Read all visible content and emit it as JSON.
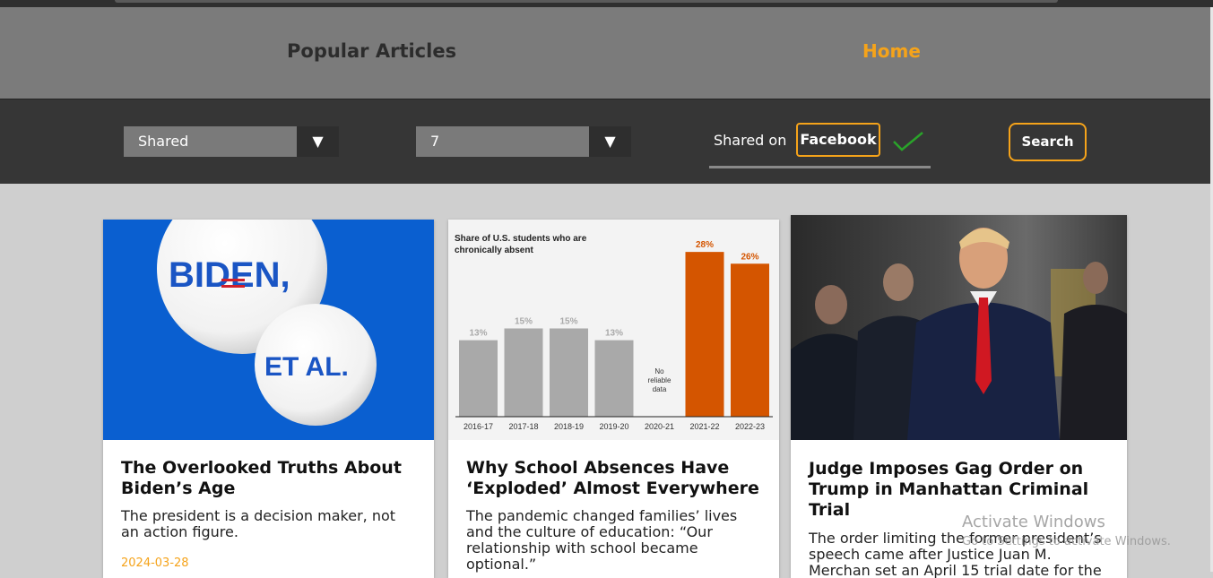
{
  "header": {
    "title": "Popular Articles",
    "home_label": "Home"
  },
  "filters": {
    "type_selected": "Shared",
    "days_selected": "7",
    "shared_on_label": "Shared on",
    "platform_label": "Facebook",
    "search_label": "Search"
  },
  "colors": {
    "accent": "#f5a31a",
    "header_bg": "#7b7b7b",
    "filterbar_bg": "#363636",
    "check": "#2aa32a"
  },
  "articles": [
    {
      "title": "The Overlooked Truths About Biden’s Age",
      "abstract": "The president is a decision maker, not an action figure.",
      "date": "2024-03-28",
      "image": {
        "button_top": "BIDEN,",
        "button_bottom": "ET AL."
      }
    },
    {
      "title": "Why School Absences Have ‘Exploded’ Almost Everywhere",
      "abstract": "The pandemic changed families’ lives and the culture of education: “Our relationship with school became optional.”",
      "image": {
        "chart_data": {
          "type": "bar",
          "title": "Share of U.S. students who are chronically absent",
          "categories": [
            "2016-17",
            "2017-18",
            "2018-19",
            "2019-20",
            "2020-21",
            "2021-22",
            "2022-23"
          ],
          "values": [
            13,
            15,
            15,
            13,
            null,
            28,
            26
          ],
          "labels": [
            "13%",
            "15%",
            "15%",
            "13%",
            "",
            "28%",
            "26%"
          ],
          "null_note": [
            "No",
            "reliable",
            "data"
          ],
          "ylim": [
            0,
            30
          ],
          "colors": {
            "before": "#a9a9a9",
            "after": "#d45500"
          }
        }
      }
    },
    {
      "title": "Judge Imposes Gag Order on Trump in Manhattan Criminal Trial",
      "abstract": "The order limiting the former president’s speech came after Justice Juan M. Merchan set an April 15 trial date for the"
    }
  ],
  "watermark": {
    "line1": "Activate Windows",
    "line2": "Go to Settings to activate Windows."
  }
}
